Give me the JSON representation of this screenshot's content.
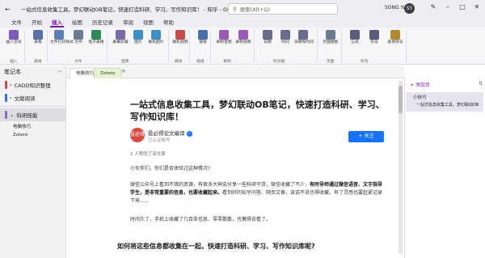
{
  "titlebar": {
    "title": "一站式信息收集工具，梦幻联动OB笔记，快速打造科研、学习、写作知识库！ - 知乎 - OneNote",
    "search_placeholder": "搜索(Alt+Q)",
    "user": "SONG Yu",
    "avatar_text": "SY"
  },
  "menu": [
    "文件",
    "开始",
    "插入",
    "绘图",
    "历史记录",
    "审阅",
    "视图",
    "帮助"
  ],
  "menu_active": "插入",
  "ribbon": {
    "buttons": [
      {
        "label": "插入空间",
        "color": "#7b5bb7"
      },
      {
        "label": "表格",
        "color": "#5a6ea8"
      },
      {
        "label": "文件打印样式",
        "color": "#5a7fb0"
      },
      {
        "label": "文件",
        "color": "#6b7b92"
      },
      {
        "label": "电子表格",
        "color": "#2e8b57"
      },
      {
        "label": "屏幕剪辑",
        "color": "#7b6aa8"
      },
      {
        "label": "图片",
        "color": "#3f8ec6"
      },
      {
        "label": "联机图片",
        "color": "#3f8ec6"
      },
      {
        "label": "联机视频",
        "color": "#c44e4e"
      },
      {
        "label": "链接",
        "color": "#4a6fa8"
      },
      {
        "label": "录制音频",
        "color": "#9a5bb7"
      },
      {
        "label": "录制视频",
        "color": "#9a5bb7"
      },
      {
        "label": "日期",
        "color": "#6a6a8a"
      },
      {
        "label": "时间",
        "color": "#6a6a8a"
      },
      {
        "label": "日期和时间",
        "color": "#6a6a8a"
      },
      {
        "label": "页面模板",
        "color": "#6b7b92"
      },
      {
        "label": "公式",
        "color": "#5a5a7a"
      },
      {
        "label": "符号",
        "color": "#5a5a7a"
      },
      {
        "label": "表情符号",
        "color": "#b08a2c"
      }
    ],
    "groups": [
      "插入",
      "表格",
      "文件",
      "图像",
      "媒体",
      "链接",
      "录制",
      "时间戳",
      "页面",
      "符号"
    ]
  },
  "sidebar": {
    "title": "笔记本",
    "notebooks": [
      {
        "label": "CADD知识整理",
        "color": "#c84a4a"
      },
      {
        "label": "文献阅读",
        "color": "#3b6fd1"
      },
      {
        "label": "科研技能",
        "color": "#8a6ad0"
      }
    ],
    "sections": [
      "电脑技巧",
      "Zotero"
    ]
  },
  "tabs": [
    "电脑技巧",
    "Zotero"
  ],
  "article": {
    "title": "一站式信息收集工具，梦幻联动OB笔记，快速打造科研、学习、写作知识库！",
    "author": "投必得论文编译",
    "author_badge": "✓",
    "author_sub": "已认证帐号",
    "avatar_text": "投必得",
    "follow": "+ 关注",
    "likes": "2 人赞同了该文章",
    "p1": "小伙伴们，你们是否体验过这种情况?",
    "p2a": "微信公众号上看到不错的资源，有很多大神会分享一些科研干货，微信收藏了不少，",
    "p2b": "有时导师通过微信语音、文字指导学生，是非常重要的信息，也要收藏起来。",
    "p2c": "看到好的知乎问答、网页文章，该说不说也得收藏。有了灵感也要赶紧记录下来......",
    "p3": "时间久了，手机上收藏了几百条信息、零零散散，也懒得去看了。",
    "h2": "如何将这些信息都收集在一起，快速打造科研、学习、写作知识库呢?"
  },
  "rightpanel": {
    "add_page": "+ 添加页",
    "pages": [
      "小技巧",
      "一站式信息收集工具，梦幻联动OB"
    ]
  }
}
